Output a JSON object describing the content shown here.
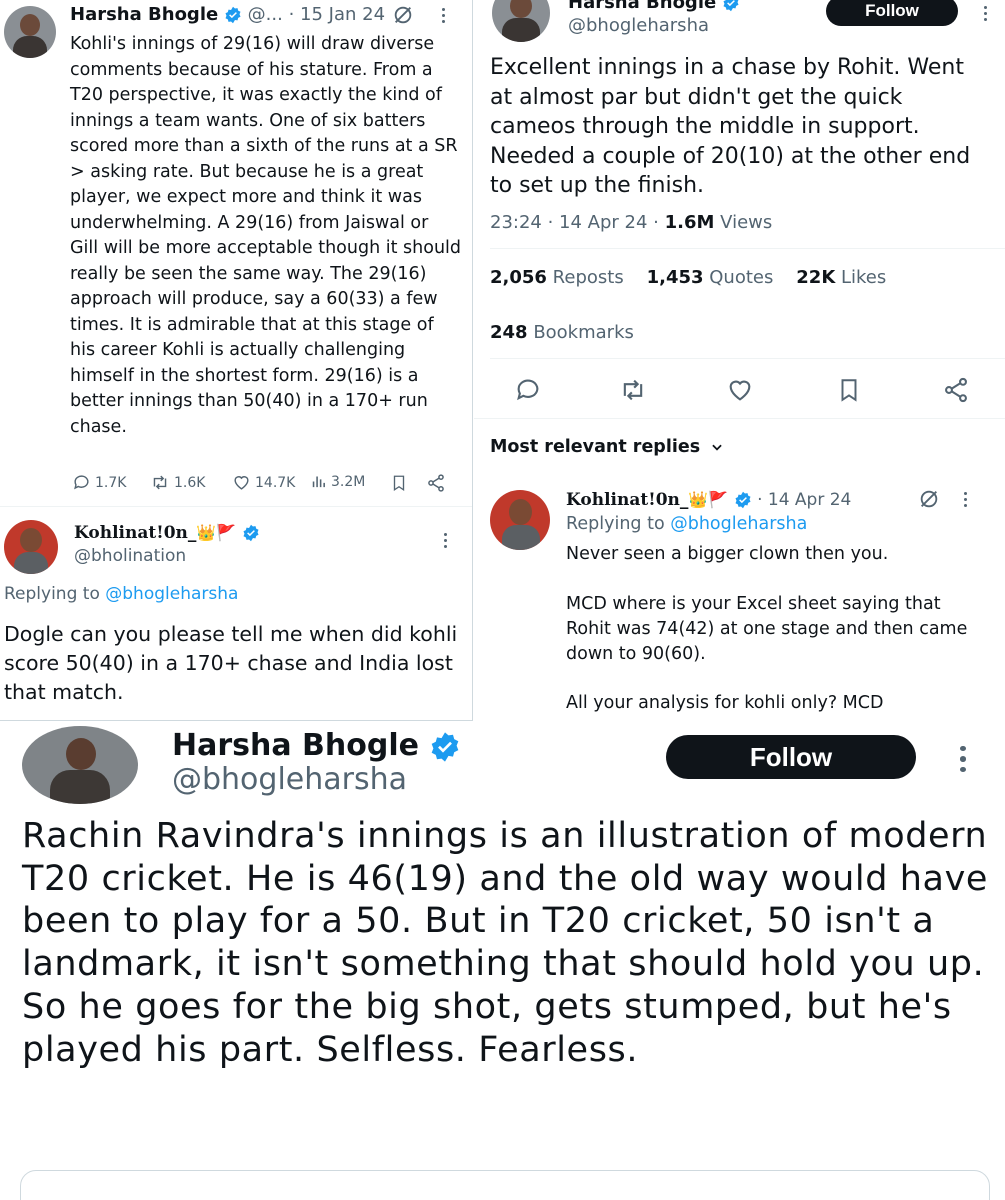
{
  "top_left": {
    "tweet": {
      "author": "Harsha Bhogle",
      "handle_truncated": "@...",
      "date": "15 Jan 24",
      "text": "Kohli's innings of 29(16) will draw diverse comments because of his stature. From a T20 perspective, it was exactly the kind of innings a team wants. One of six batters scored more than a sixth of the runs at a SR > asking rate. But because he is a great player, we expect more and think it was underwhelming. A 29(16) from Jaiswal or Gill will be more acceptable though it should really be seen the same way. The 29(16) approach will produce, say a 60(33) a few times. It is admirable that at this stage of his career Kohli is actually challenging himself in the shortest form. 29(16) is a better innings than 50(40) in a 170+ run chase.",
      "replies": "1.7K",
      "reposts": "1.6K",
      "likes": "14.7K",
      "views": "3.2M"
    },
    "reply": {
      "author": "Kohlinat!0n_",
      "emoji": "👑🚩",
      "handle": "@bholination",
      "replying_prefix": "Replying to ",
      "replying_handle": "@bhogleharsha",
      "text": "Dogle can you please tell me when did kohli score 50(40) in a 170+ chase and India lost that match."
    }
  },
  "top_right": {
    "tweet": {
      "author": "Harsha Bhogle",
      "handle": "@bhogleharsha",
      "follow_label": "Follow",
      "text": "Excellent innings in a chase by Rohit. Went at almost par but didn't get the quick cameos through the middle in support. Needed a couple of 20(10) at the other end to set up the finish.",
      "time": "23:24",
      "date": "14 Apr 24",
      "views_count": "1.6M",
      "views_label": "Views",
      "reposts_count": "2,056",
      "reposts_label": "Reposts",
      "quotes_count": "1,453",
      "quotes_label": "Quotes",
      "likes_count": "22K",
      "likes_label": "Likes",
      "bookmarks_count": "248",
      "bookmarks_label": "Bookmarks"
    },
    "replies_header": "Most relevant replies",
    "reply": {
      "author": "Kohlinat!0n_",
      "emoji": "👑🚩",
      "date": "14 Apr 24",
      "replying_prefix": "Replying to ",
      "replying_handle": "@bhogleharsha",
      "line1": "Never seen a bigger clown then you.",
      "line2": "MCD where is your Excel sheet saying that Rohit was 74(42) at one stage and then came down to 90(60).",
      "line3": "All your analysis for kohli only? MCD"
    }
  },
  "bottom": {
    "tweet": {
      "author": "Harsha Bhogle",
      "handle": "@bhogleharsha",
      "follow_label": "Follow",
      "text": "Rachin Ravindra's innings is an illustration of modern T20 cricket. He is 46(19) and the old way would have been to play for a 50. But in T20 cricket, 50 isn't a landmark, it isn't something that should hold you up. So he goes for the big shot, gets stumped, but he's played his part. Selfless. Fearless."
    }
  },
  "colors": {
    "text": "#0f1419",
    "secondary": "#536471",
    "link": "#1d9bf0",
    "verified": "#1d9bf0",
    "crown": "#f5b301",
    "flag": "#e0245e",
    "button": "#0f1419"
  }
}
